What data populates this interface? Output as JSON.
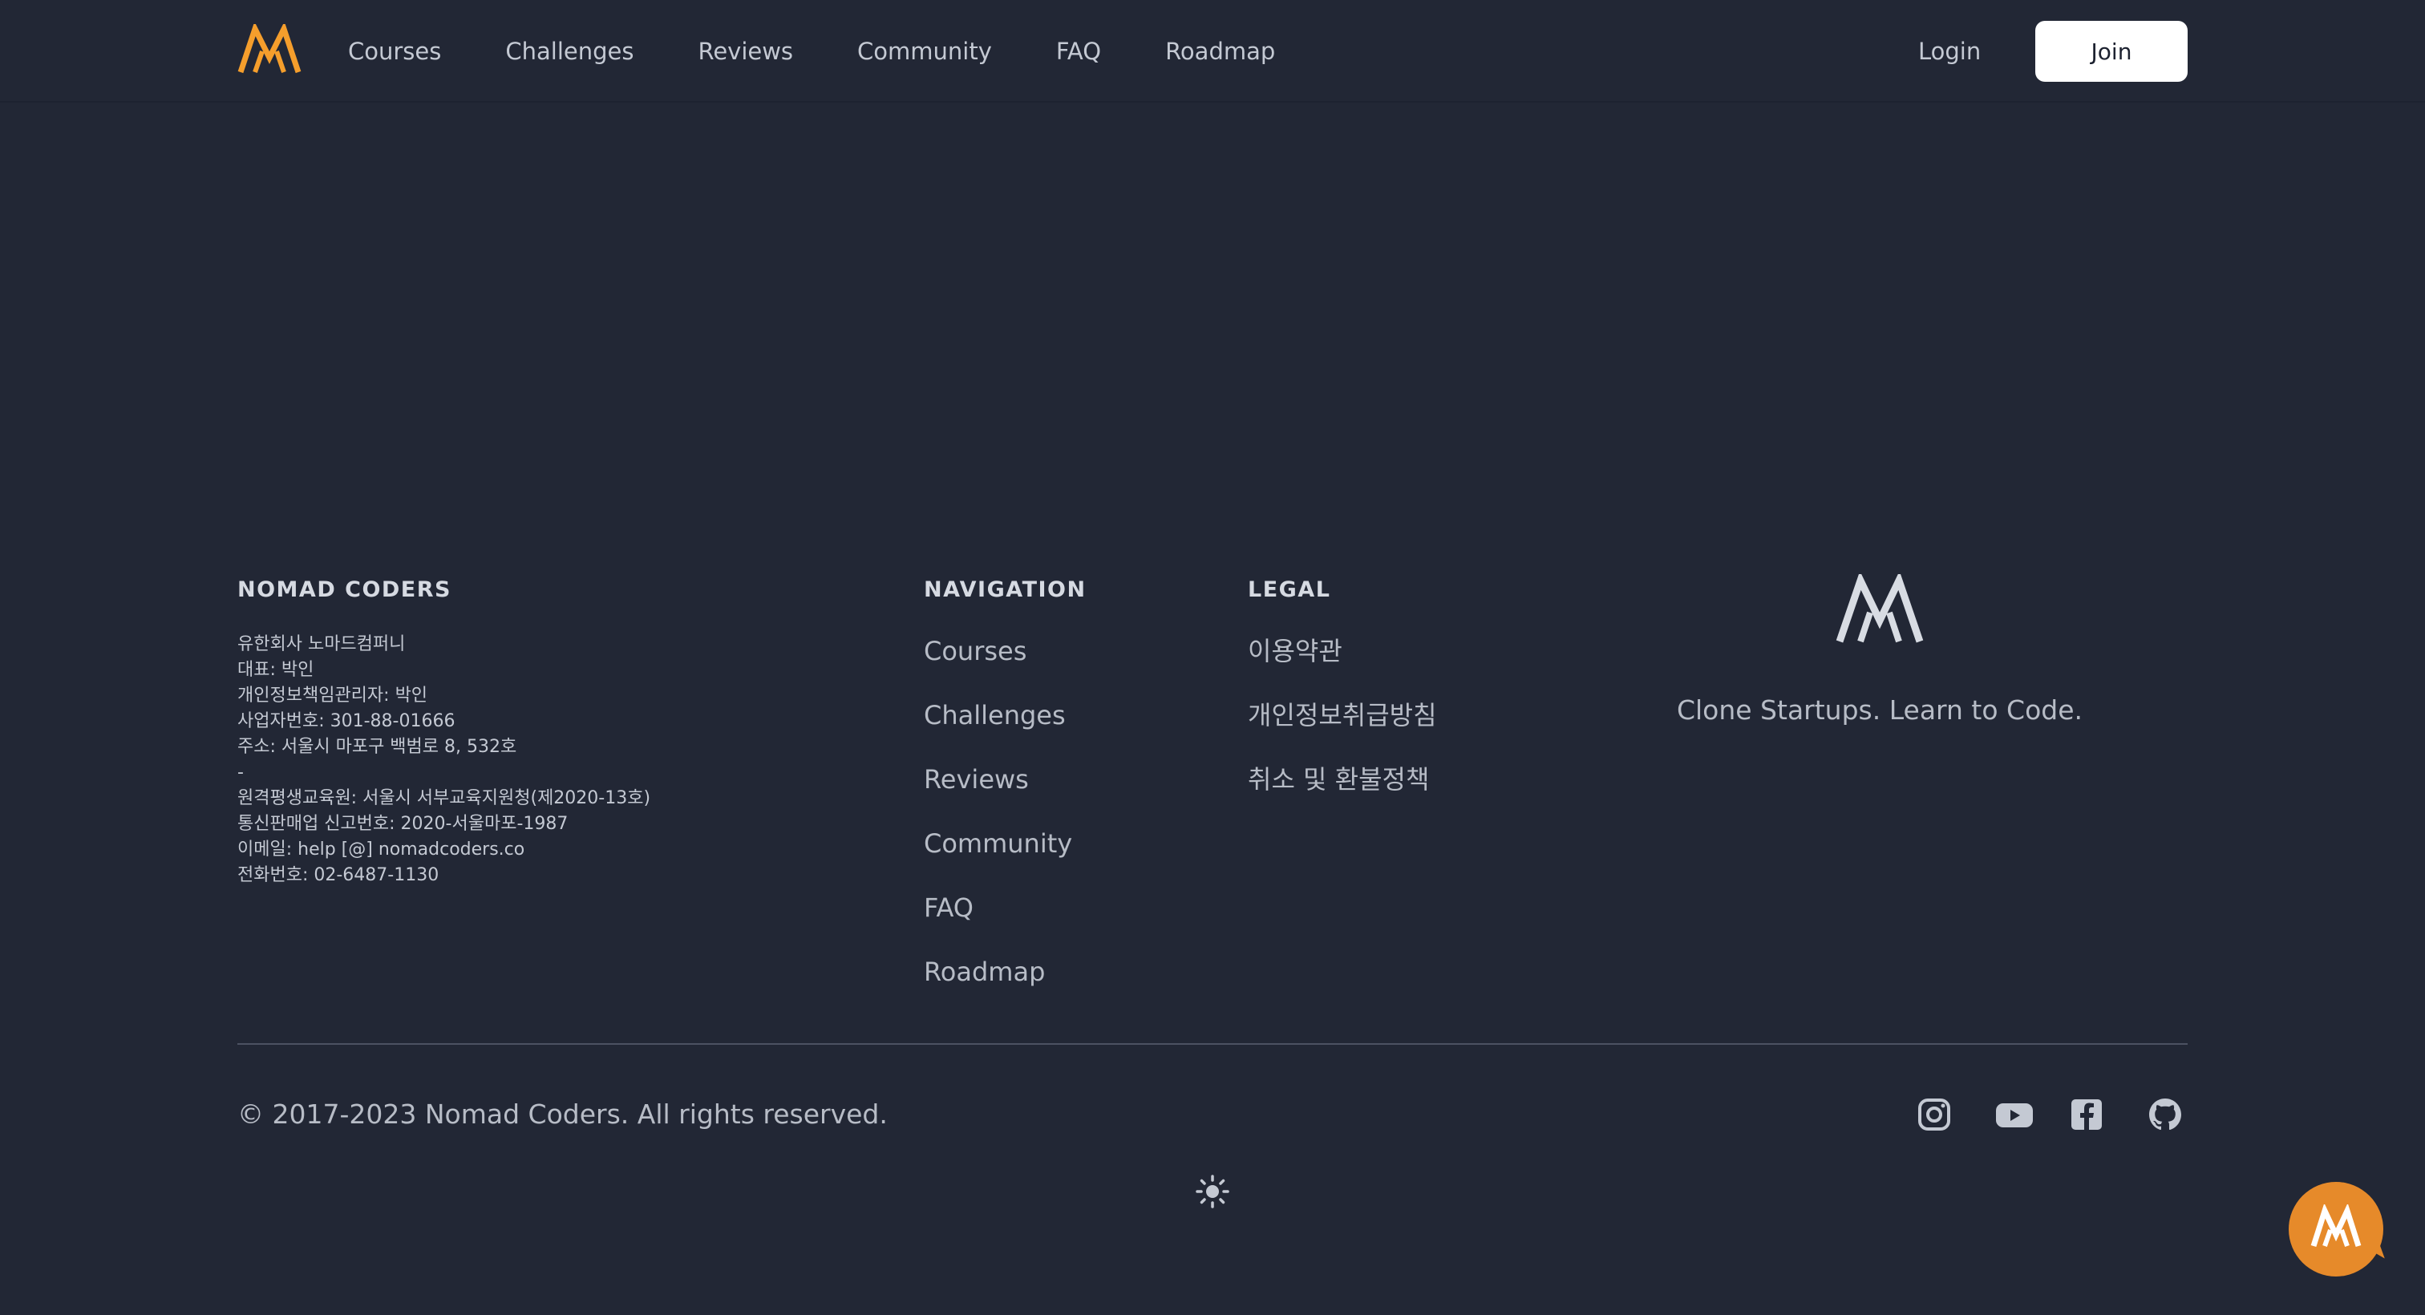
{
  "header": {
    "logo_icon": "nomad-coders-logo-icon",
    "nav_items": [
      "Courses",
      "Challenges",
      "Reviews",
      "Community",
      "FAQ",
      "Roadmap"
    ],
    "login_label": "Login",
    "join_label": "Join",
    "accent_color": "#f59e2c"
  },
  "footer": {
    "company": {
      "title": "NOMAD CODERS",
      "lines": [
        "유한회사 노마드컴퍼니",
        "대표: 박인",
        "개인정보책임관리자: 박인",
        "사업자번호: 301-88-01666",
        "주소: 서울시 마포구 백범로 8, 532호",
        "-",
        "원격평생교육원: 서울시 서부교육지원청(제2020-13호)",
        "통신판매업 신고번호: 2020-서울마포-1987",
        "이메일: help [@] nomadcoders.co",
        "전화번호: 02-6487-1130"
      ]
    },
    "navigation": {
      "title": "NAVIGATION",
      "links": [
        "Courses",
        "Challenges",
        "Reviews",
        "Community",
        "FAQ",
        "Roadmap"
      ]
    },
    "legal": {
      "title": "LEGAL",
      "links": [
        "이용약관",
        "개인정보취급방침",
        "취소 및 환불정책"
      ]
    },
    "brand": {
      "icon": "nomad-coders-logo-icon",
      "tagline": "Clone Startups. Learn to Code."
    },
    "copyright": "© 2017-2023 Nomad Coders. All rights reserved.",
    "social_icons": [
      "instagram-icon",
      "youtube-icon",
      "facebook-icon",
      "github-icon"
    ],
    "theme_toggle_icon": "sun-icon",
    "chat_button_icon": "chat-logo-icon",
    "chat_color": "#e68a2a"
  }
}
